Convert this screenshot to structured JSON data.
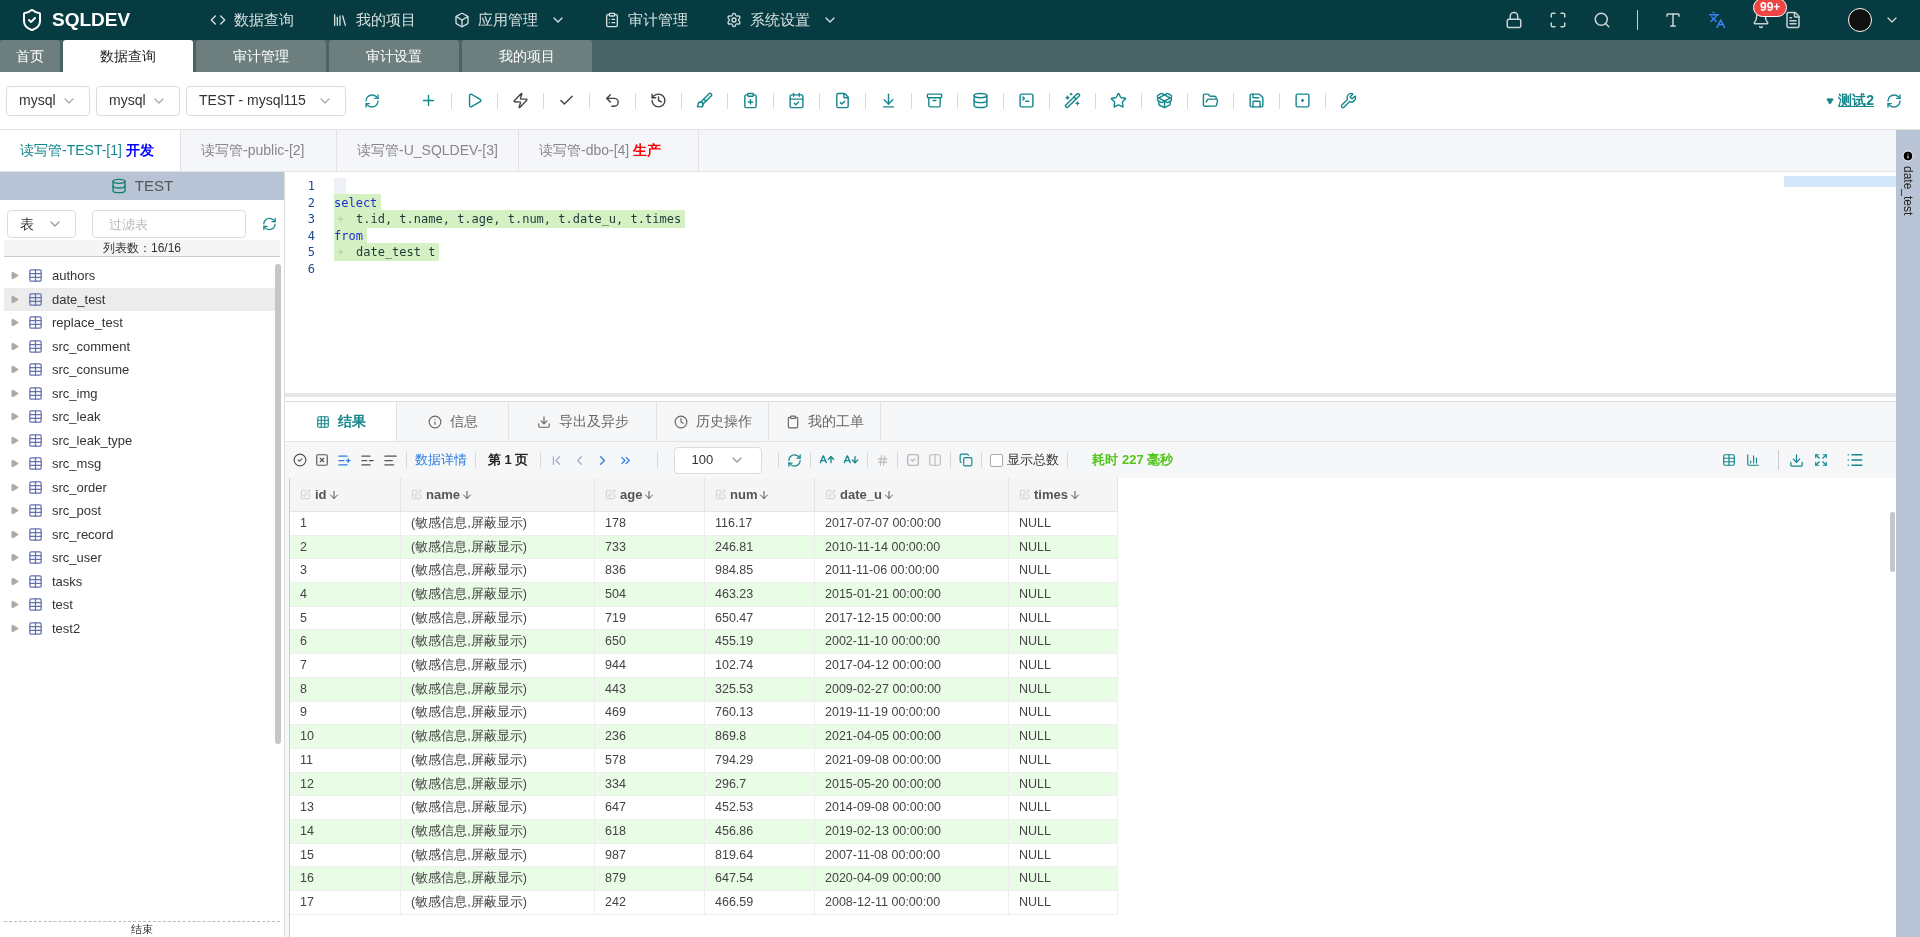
{
  "nav": {
    "logo": "SQLDEV",
    "items": [
      {
        "label": "数据查询",
        "dropdown": false
      },
      {
        "label": "我的项目",
        "dropdown": false
      },
      {
        "label": "应用管理",
        "dropdown": true
      },
      {
        "label": "审计管理",
        "dropdown": false
      },
      {
        "label": "系统设置",
        "dropdown": true
      }
    ],
    "notification_badge": "99+"
  },
  "page_tabs": [
    {
      "label": "首页",
      "selected": false
    },
    {
      "label": "数据查询",
      "selected": true
    },
    {
      "label": "审计管理",
      "selected": false
    },
    {
      "label": "审计设置",
      "selected": false
    },
    {
      "label": "我的项目",
      "selected": false
    }
  ],
  "toolbar": {
    "selects": [
      "mysql",
      "mysql",
      "TEST - mysql115"
    ],
    "user_link": "测试2"
  },
  "query_tabs": [
    {
      "label": "读写管-TEST-[1]",
      "selected": true,
      "tag": {
        "text": "开发",
        "color": "#0000ff"
      }
    },
    {
      "label": "读写管-public-[2]",
      "selected": false
    },
    {
      "label": "读写管-U_SQLDEV-[3]",
      "selected": false
    },
    {
      "label": "读写管-dbo-[4]",
      "selected": false,
      "tag": {
        "text": "生产",
        "color": "#ff0000"
      }
    }
  ],
  "sidebar": {
    "title": "TEST",
    "type_select": "表",
    "filter_placeholder": "过滤表",
    "count": "列表数：16/16",
    "footer": "结束",
    "tables": [
      {
        "name": "authors",
        "selected": false
      },
      {
        "name": "date_test",
        "selected": true
      },
      {
        "name": "replace_test",
        "selected": false
      },
      {
        "name": "src_comment",
        "selected": false
      },
      {
        "name": "src_consume",
        "selected": false
      },
      {
        "name": "src_img",
        "selected": false
      },
      {
        "name": "src_leak",
        "selected": false
      },
      {
        "name": "src_leak_type",
        "selected": false
      },
      {
        "name": "src_msg",
        "selected": false
      },
      {
        "name": "src_order",
        "selected": false
      },
      {
        "name": "src_post",
        "selected": false
      },
      {
        "name": "src_record",
        "selected": false
      },
      {
        "name": "src_user",
        "selected": false
      },
      {
        "name": "tasks",
        "selected": false
      },
      {
        "name": "test",
        "selected": false
      },
      {
        "name": "test2",
        "selected": false
      }
    ]
  },
  "editor": {
    "lines": [
      {
        "number": "1"
      },
      {
        "number": "2",
        "text": "select",
        "kind": "keyword",
        "indented": false
      },
      {
        "number": "3",
        "text": "t.id, t.name, t.age, t.num, t.date_u, t.times",
        "kind": "plain",
        "indented": true
      },
      {
        "number": "4",
        "text": "from",
        "kind": "keyword",
        "indented": false
      },
      {
        "number": "5",
        "text": "date_test t",
        "kind": "plain",
        "indented": true
      },
      {
        "number": "6"
      }
    ]
  },
  "right_panel": {
    "label": "date_test"
  },
  "results": {
    "tabs": [
      {
        "label": "结果",
        "selected": true
      },
      {
        "label": "信息",
        "selected": false
      },
      {
        "label": "导出及异步",
        "selected": false
      },
      {
        "label": "历史操作",
        "selected": false
      },
      {
        "label": "我的工单",
        "selected": false
      }
    ],
    "toolbar": {
      "detail_link": "数据详情",
      "page": "第 1 页",
      "page_size": "100",
      "show_total": {
        "label": "显示总数",
        "checked": false
      },
      "elapsed": "耗时 227 毫秒"
    },
    "table": {
      "columns": [
        "id",
        "name",
        "age",
        "num",
        "date_u",
        "times"
      ],
      "rows": [
        [
          "1",
          "(敏感信息,屏蔽显示)",
          "178",
          "116.17",
          "2017-07-07 00:00:00",
          "NULL"
        ],
        [
          "2",
          "(敏感信息,屏蔽显示)",
          "733",
          "246.81",
          "2010-11-14 00:00:00",
          "NULL"
        ],
        [
          "3",
          "(敏感信息,屏蔽显示)",
          "836",
          "984.85",
          "2011-11-06 00:00:00",
          "NULL"
        ],
        [
          "4",
          "(敏感信息,屏蔽显示)",
          "504",
          "463.23",
          "2015-01-21 00:00:00",
          "NULL"
        ],
        [
          "5",
          "(敏感信息,屏蔽显示)",
          "719",
          "650.47",
          "2017-12-15 00:00:00",
          "NULL"
        ],
        [
          "6",
          "(敏感信息,屏蔽显示)",
          "650",
          "455.19",
          "2002-11-10 00:00:00",
          "NULL"
        ],
        [
          "7",
          "(敏感信息,屏蔽显示)",
          "944",
          "102.74",
          "2017-04-12 00:00:00",
          "NULL"
        ],
        [
          "8",
          "(敏感信息,屏蔽显示)",
          "443",
          "325.53",
          "2009-02-27 00:00:00",
          "NULL"
        ],
        [
          "9",
          "(敏感信息,屏蔽显示)",
          "469",
          "760.13",
          "2019-11-19 00:00:00",
          "NULL"
        ],
        [
          "10",
          "(敏感信息,屏蔽显示)",
          "236",
          "869.8",
          "2021-04-05 00:00:00",
          "NULL"
        ],
        [
          "11",
          "(敏感信息,屏蔽显示)",
          "578",
          "794.29",
          "2021-09-08 00:00:00",
          "NULL"
        ],
        [
          "12",
          "(敏感信息,屏蔽显示)",
          "334",
          "296.7",
          "2015-05-20 00:00:00",
          "NULL"
        ],
        [
          "13",
          "(敏感信息,屏蔽显示)",
          "647",
          "452.53",
          "2014-09-08 00:00:00",
          "NULL"
        ],
        [
          "14",
          "(敏感信息,屏蔽显示)",
          "618",
          "456.86",
          "2019-02-13 00:00:00",
          "NULL"
        ],
        [
          "15",
          "(敏感信息,屏蔽显示)",
          "987",
          "819.64",
          "2007-11-08 00:00:00",
          "NULL"
        ],
        [
          "16",
          "(敏感信息,屏蔽显示)",
          "879",
          "647.54",
          "2020-04-09 00:00:00",
          "NULL"
        ],
        [
          "17",
          "(敏感信息,屏蔽显示)",
          "242",
          "466.59",
          "2008-12-11 00:00:00",
          "NULL"
        ]
      ]
    }
  }
}
